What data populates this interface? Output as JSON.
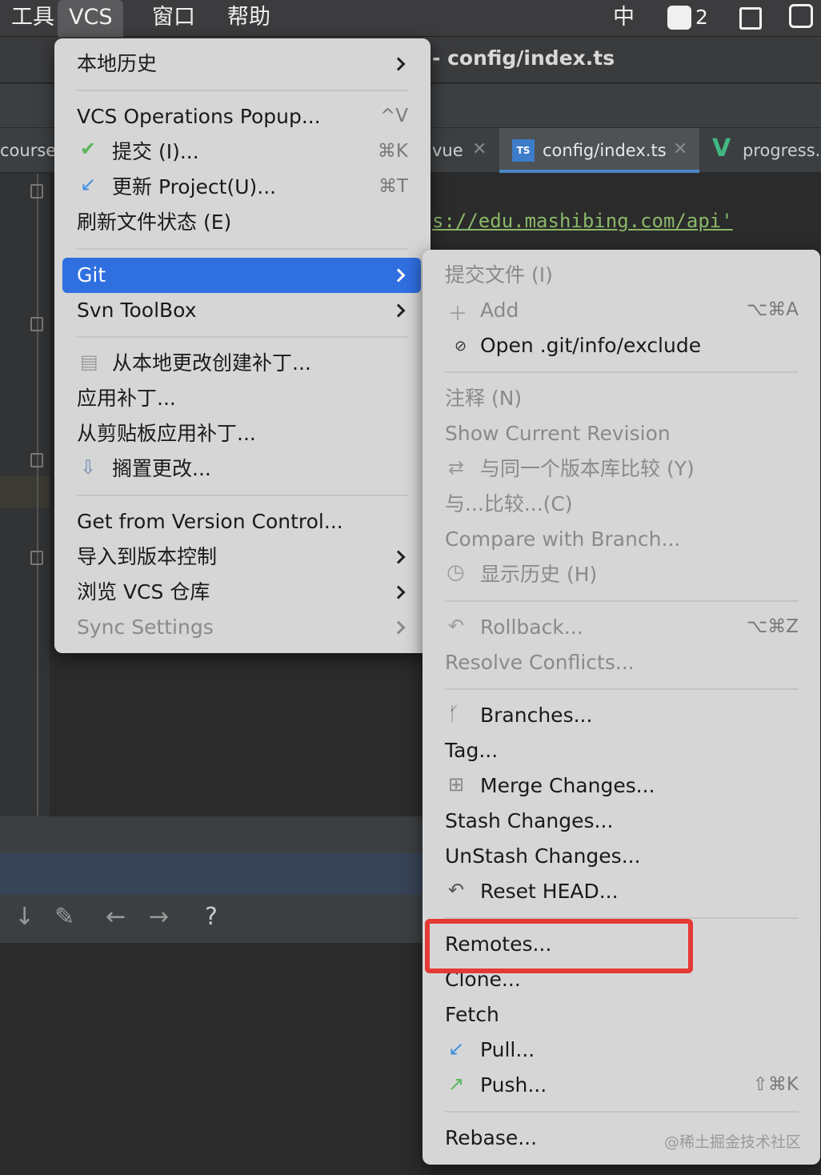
{
  "menubar": {
    "tools": "工具",
    "vcs": "VCS",
    "window": "窗口",
    "help": "帮助",
    "ime": "中",
    "badge_count": "2"
  },
  "title": {
    "text": "- config/index.ts"
  },
  "tabs": [
    {
      "label": "course."
    },
    {
      "label": "vue"
    },
    {
      "label": "config/index.ts",
      "badge": "TS"
    },
    {
      "label": "progress.v"
    }
  ],
  "editor": {
    "url_fragment": "s://edu.mashibing.com/api'"
  },
  "bottom": {
    "help": "?"
  },
  "vcs_menu": {
    "local_history": "本地历史",
    "ops_popup": "VCS Operations Popup...",
    "ops_popup_sc": "^V",
    "commit": "提交 (I)...",
    "commit_sc": "⌘K",
    "update": "更新 Project(U)...",
    "update_sc": "⌘T",
    "refresh": "刷新文件状态 (E)",
    "git": "Git",
    "svn": "Svn ToolBox",
    "create_patch": "从本地更改创建补丁...",
    "apply_patch": "应用补丁...",
    "apply_clipboard": "从剪贴板应用补丁...",
    "shelve": "搁置更改...",
    "get_from_vc": "Get from Version Control...",
    "import_vc": "导入到版本控制",
    "browse_vcs": "浏览 VCS 仓库",
    "sync": "Sync Settings"
  },
  "git_menu": {
    "commit_file": "提交文件 (I)",
    "add": "Add",
    "add_sc": "⌥⌘A",
    "open_exclude": "Open .git/info/exclude",
    "annotate": "注释 (N)",
    "show_rev": "Show Current Revision",
    "compare_same": "与同一个版本库比较 (Y)",
    "compare_with": "与...比较...(C)",
    "compare_branch": "Compare with Branch...",
    "show_history": "显示历史 (H)",
    "rollback": "Rollback...",
    "rollback_sc": "⌥⌘Z",
    "resolve": "Resolve Conflicts...",
    "branches": "Branches...",
    "tag": "Tag...",
    "merge": "Merge Changes...",
    "stash": "Stash Changes...",
    "unstash": "UnStash Changes...",
    "reset_head": "Reset HEAD...",
    "remotes": "Remotes...",
    "clone": "Clone...",
    "fetch": "Fetch",
    "pull": "Pull...",
    "push": "Push...",
    "push_sc": "⇧⌘K",
    "rebase": "Rebase..."
  },
  "watermark": "@稀土掘金技术社区",
  "colors": {
    "selection": "#2f6fe0",
    "highlight_box": "#e53935",
    "menu_bg": "#d6d6d6",
    "check_green": "#5cb85c",
    "update_blue": "#3d8ee0"
  },
  "icons": {
    "commit": "check-icon",
    "update": "arrow-down-left-icon",
    "add": "plus-icon",
    "exclude": "blocked-icon",
    "history": "clock-icon",
    "rollback": "undo-icon",
    "branches": "branch-icon",
    "pull": "arrow-down-left-icon",
    "push": "arrow-up-right-icon"
  }
}
